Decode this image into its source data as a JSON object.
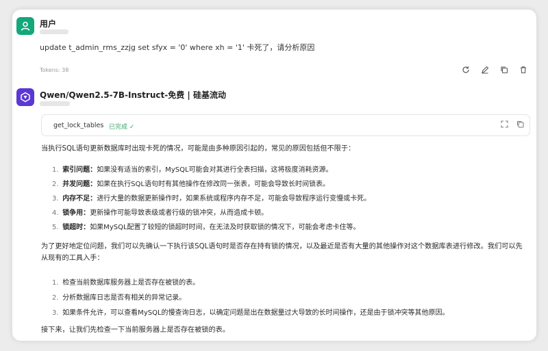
{
  "user": {
    "name": "用户",
    "message": "update t_admin_rms_zzjg set sfyx = '0' where xh = '1' 卡死了，请分析原因",
    "tokens": "Tokens: 38"
  },
  "assistant": {
    "name": "Qwen/Qwen2.5-7B-Instruct-免费 | 硅基流动",
    "tool": {
      "name": "get_lock_tables",
      "status": "已完成 ✓"
    },
    "intro": "当执行SQL语句更新数据库时出现卡死的情况，可能是由多种原因引起的，常见的原因包括但不限于：",
    "causes": [
      {
        "num": "1.",
        "title": "索引问题：",
        "text": "如果没有适当的索引，MySQL可能会对其进行全表扫描，这将极度消耗资源。"
      },
      {
        "num": "2.",
        "title": "并发问题：",
        "text": "如果在执行SQL语句时有其他操作在修改同一张表，可能会导致长时间锁表。"
      },
      {
        "num": "3.",
        "title": "内存不足：",
        "text": "进行大量的数据更新操作时，如果系统或程序内存不足，可能会导致程序运行变慢或卡死。"
      },
      {
        "num": "4.",
        "title": "锁争用：",
        "text": "更新操作可能导致表级或者行级的锁冲突，从而造成卡顿。"
      },
      {
        "num": "5.",
        "title": "锁超时：",
        "text": "如果MySQL配置了较短的锁超时时间，在无法及时获取锁的情况下，可能会考虑卡住等。"
      }
    ],
    "para2": "为了更好地定位问题，我们可以先确认一下执行该SQL语句时是否存在持有锁的情况，以及最近是否有大量的其他操作对这个数据库表进行修改。我们可以先从现有的工具入手：",
    "steps": [
      {
        "num": "1.",
        "text": "检查当前数据库服务器上是否存在被锁的表。"
      },
      {
        "num": "2.",
        "text": "分析数据库日志是否有相关的异常记录。"
      },
      {
        "num": "3.",
        "text": "如果条件允许，可以查看MySQL的慢查询日志，以确定问题是出在数据量过大导致的长时间操作，还是由于锁冲突等其他原因。"
      }
    ],
    "closing": "接下来，让我们先检查一下当前服务器上是否存在被锁的表。"
  },
  "colors": {
    "user_avatar": "#12a87a",
    "bot_avatar": "#5b37d4",
    "status_green": "#3aa66b"
  },
  "icons": [
    "user-icon",
    "refresh-icon",
    "edit-icon",
    "copy-icon",
    "delete-icon",
    "qwen-logo-icon",
    "expand-icon",
    "copy-icon"
  ]
}
